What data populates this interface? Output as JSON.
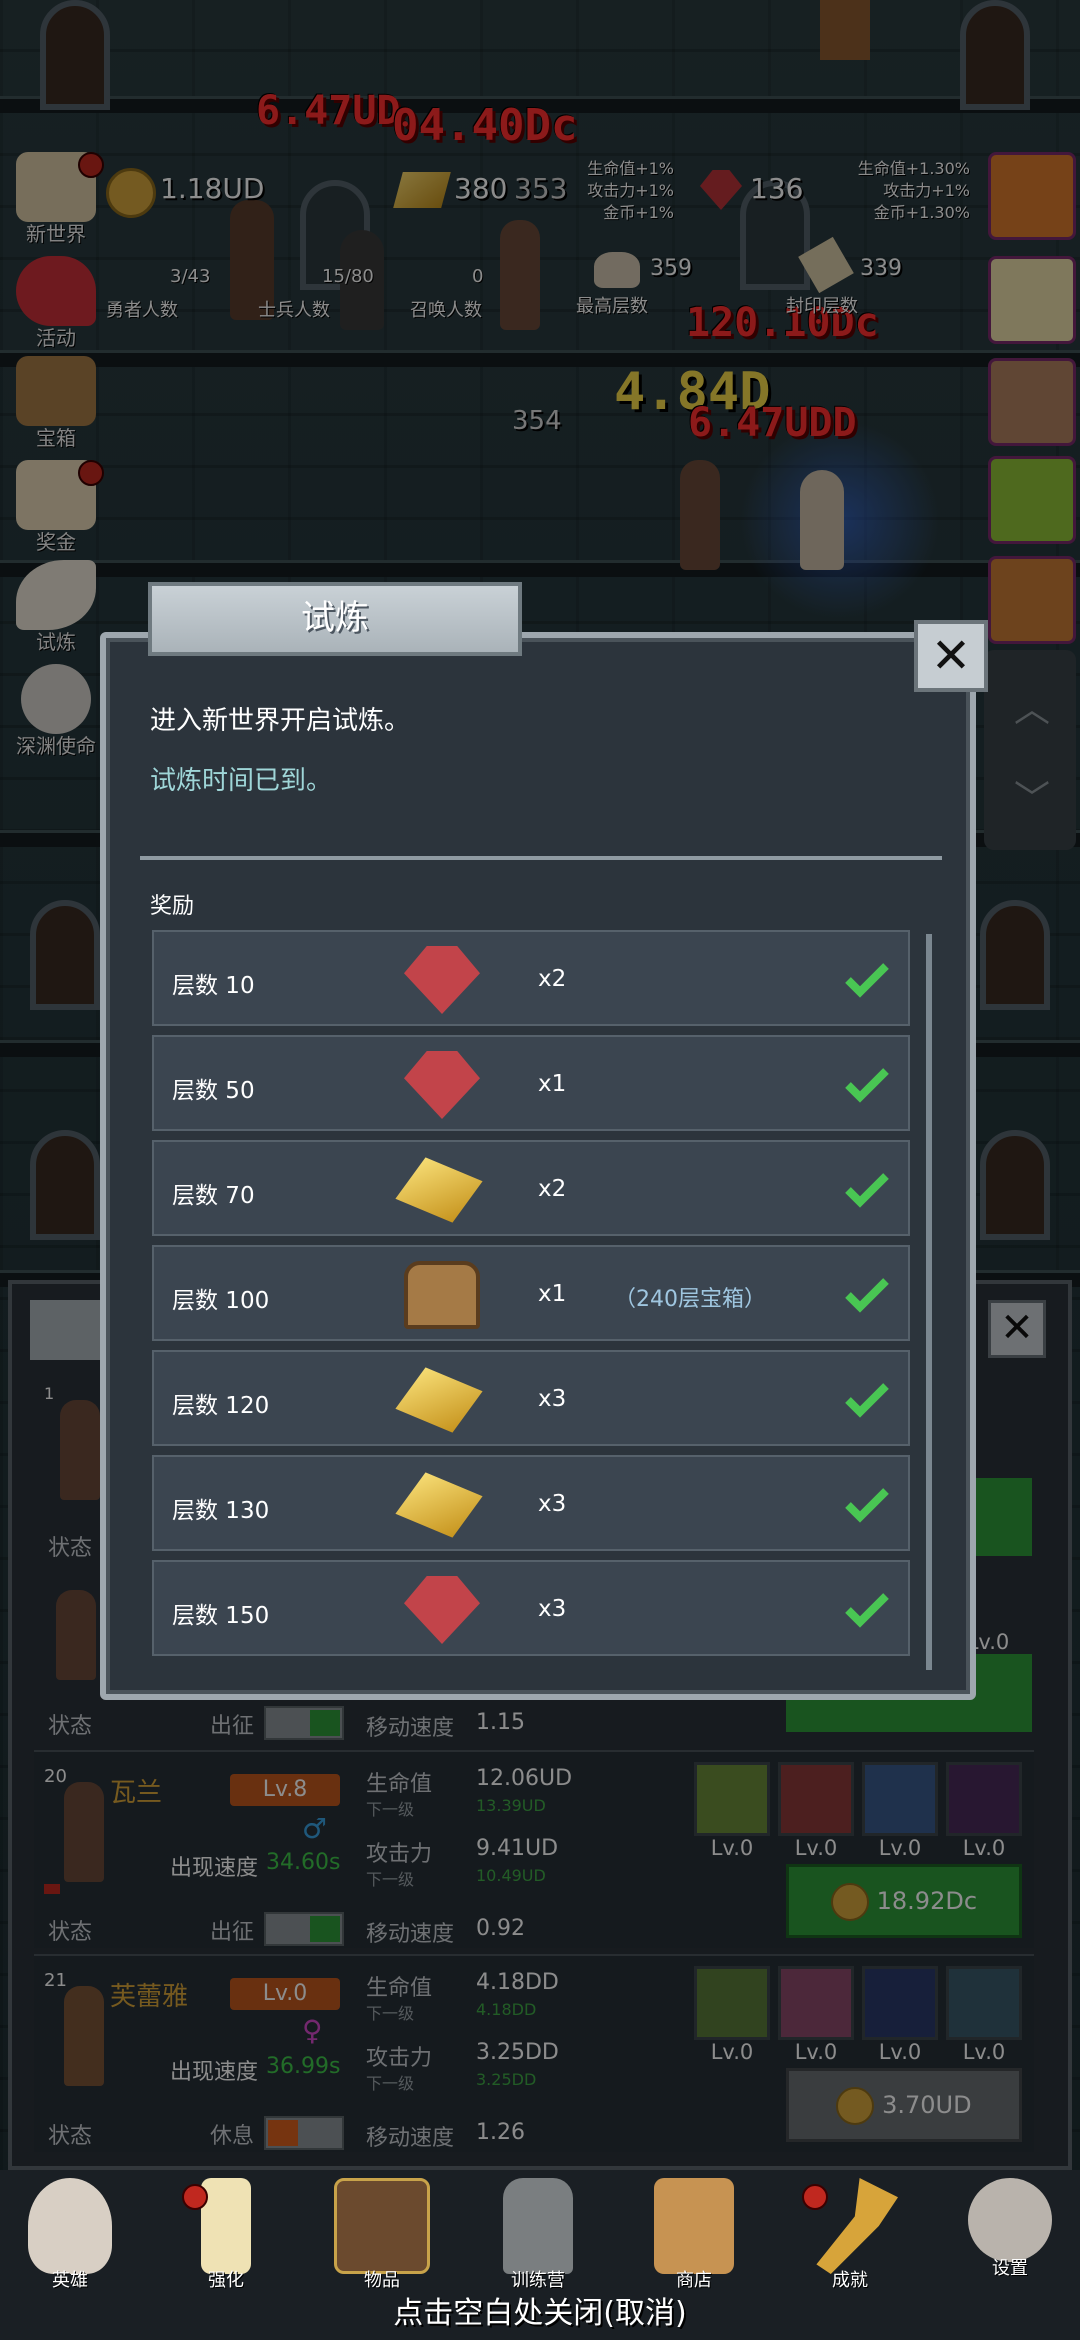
{
  "hud": {
    "gold": "1.18UD",
    "bars": "380",
    "bars_secondary": "353",
    "gems": "136",
    "bonus_left": [
      "生命值+1%",
      "攻击力+1%",
      "金币+1%"
    ],
    "bonus_right": [
      "生命值+1.30%",
      "攻击力+1%",
      "金币+1.30%"
    ],
    "brave_count": "3/43",
    "brave_label": "勇者人数",
    "soldier_count": "15/80",
    "soldier_label": "士兵人数",
    "summon_count": "0",
    "summon_label": "召唤人数",
    "max_floor_count": "359",
    "max_floor_label": "最高层数",
    "seal_floor_count": "339",
    "seal_floor_label": "封印层数",
    "floor_number": "354"
  },
  "damage_texts": [
    "6.47UD",
    "04.40Dc",
    "120.10Dc",
    "4.84D",
    "6.47UDD"
  ],
  "left_menu": [
    {
      "label": "新世界",
      "icon": "scroll-map-icon",
      "dot": true
    },
    {
      "label": "活动",
      "icon": "heart-icon",
      "dot": false
    },
    {
      "label": "宝箱",
      "icon": "treasure-chest-icon",
      "dot": false
    },
    {
      "label": "奖金",
      "icon": "envelope-icon",
      "dot": true
    },
    {
      "label": "试炼",
      "icon": "feather-icon",
      "dot": false
    },
    {
      "label": "深渊使命",
      "icon": "orb-icon",
      "dot": false
    }
  ],
  "dialog": {
    "title": "试炼",
    "message": "进入新世界开启试炼。",
    "sub_message": "试炼时间已到。",
    "rewards_heading": "奖励",
    "rewards": [
      {
        "floor": "层数 10",
        "item": "ruby-gem-icon",
        "qty": "x2",
        "note": ""
      },
      {
        "floor": "层数 50",
        "item": "ruby-gem-icon",
        "qty": "x1",
        "note": ""
      },
      {
        "floor": "层数 70",
        "item": "gold-bar-icon",
        "qty": "x2",
        "note": ""
      },
      {
        "floor": "层数 100",
        "item": "treasure-chest-icon",
        "qty": "x1",
        "note": "（240层宝箱）"
      },
      {
        "floor": "层数 120",
        "item": "gold-bar-icon",
        "qty": "x3",
        "note": ""
      },
      {
        "floor": "层数 130",
        "item": "gold-bar-icon",
        "qty": "x3",
        "note": ""
      },
      {
        "floor": "层数 150",
        "item": "ruby-gem-icon",
        "qty": "x3",
        "note": ""
      }
    ]
  },
  "heroes": {
    "status_label": "状态",
    "dispatch_label": "出征",
    "rest_label": "休息",
    "move_speed_label": "移动速度",
    "hp_label": "生命值",
    "atk_label": "攻击力",
    "next_level_label": "下一级",
    "spawn_speed_label": "出现速度",
    "partial_row": {
      "index": "1",
      "move_speed": "1.15",
      "skill_lv": "Lv.0"
    },
    "list": [
      {
        "index": "20",
        "name": "瓦兰",
        "level": "Lv.8",
        "spawn_speed": "34.60s",
        "hp": "12.06UD",
        "hp_next": "13.39UD",
        "atk": "9.41UD",
        "atk_next": "10.49UD",
        "move_speed": "0.92",
        "status": "出征",
        "skills": [
          "Lv.0",
          "Lv.0",
          "Lv.0",
          "Lv.0"
        ],
        "cost": "18.92Dc",
        "button": "green"
      },
      {
        "index": "21",
        "name": "芙蕾雅",
        "level": "Lv.0",
        "spawn_speed": "36.99s",
        "hp": "4.18DD",
        "hp_next": "4.18DD",
        "atk": "3.25DD",
        "atk_next": "3.25DD",
        "move_speed": "1.26",
        "status": "休息",
        "skills": [
          "Lv.0",
          "Lv.0",
          "Lv.0",
          "Lv.0"
        ],
        "cost": "3.70UD",
        "button": "gray"
      }
    ]
  },
  "nav": [
    {
      "label": "英雄",
      "icon": "skull-icon",
      "dot": false
    },
    {
      "label": "强化",
      "icon": "candle-icon",
      "dot": true
    },
    {
      "label": "物品",
      "icon": "book-icon",
      "dot": false
    },
    {
      "label": "训练营",
      "icon": "lantern-icon",
      "dot": false
    },
    {
      "label": "商店",
      "icon": "beer-mug-icon",
      "dot": false
    },
    {
      "label": "成就",
      "icon": "key-icon",
      "dot": true
    },
    {
      "label": "设置",
      "icon": "gear-icon",
      "dot": false
    }
  ],
  "close_hint": "点击空白处关闭(取消)"
}
